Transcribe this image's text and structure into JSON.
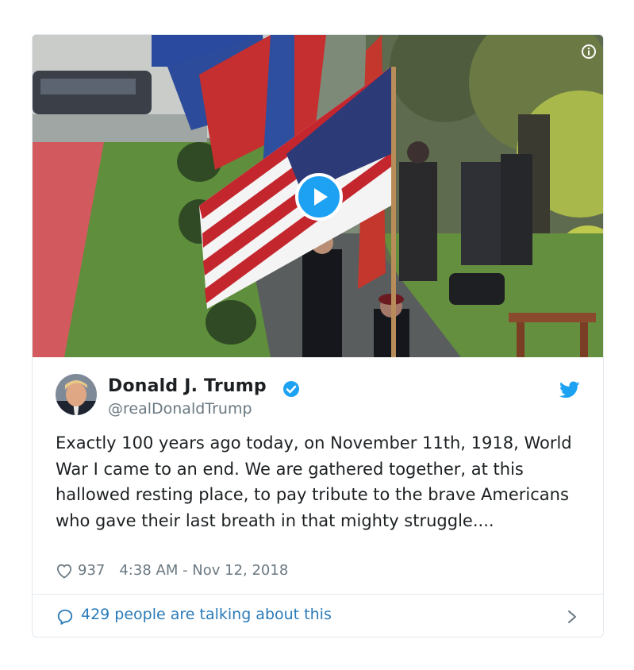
{
  "tweet": {
    "author_name": "Donald J. Trump",
    "handle": "@realDonaldTrump",
    "text": "Exactly 100 years ago today, on November 11th, 1918, World War I came to an end. We are gathered together, at this hallowed resting place, to pay tribute to the brave Americans who gave their last breath in that mighty struggle....",
    "likes": "937",
    "timestamp": "4:38 AM - Nov 12, 2018",
    "conversation": "429 people are talking about this"
  },
  "icons": {
    "info": "info-icon",
    "play": "play-icon",
    "verified": "verified-badge-icon",
    "brand": "twitter-bird-icon",
    "like": "heart-icon",
    "reply": "speech-bubble-icon",
    "more": "chevron-right-icon"
  },
  "colors": {
    "accent": "#1da1f2",
    "link": "#2b7bb9",
    "secondary_text": "#697882",
    "border": "#e1e8ed"
  }
}
